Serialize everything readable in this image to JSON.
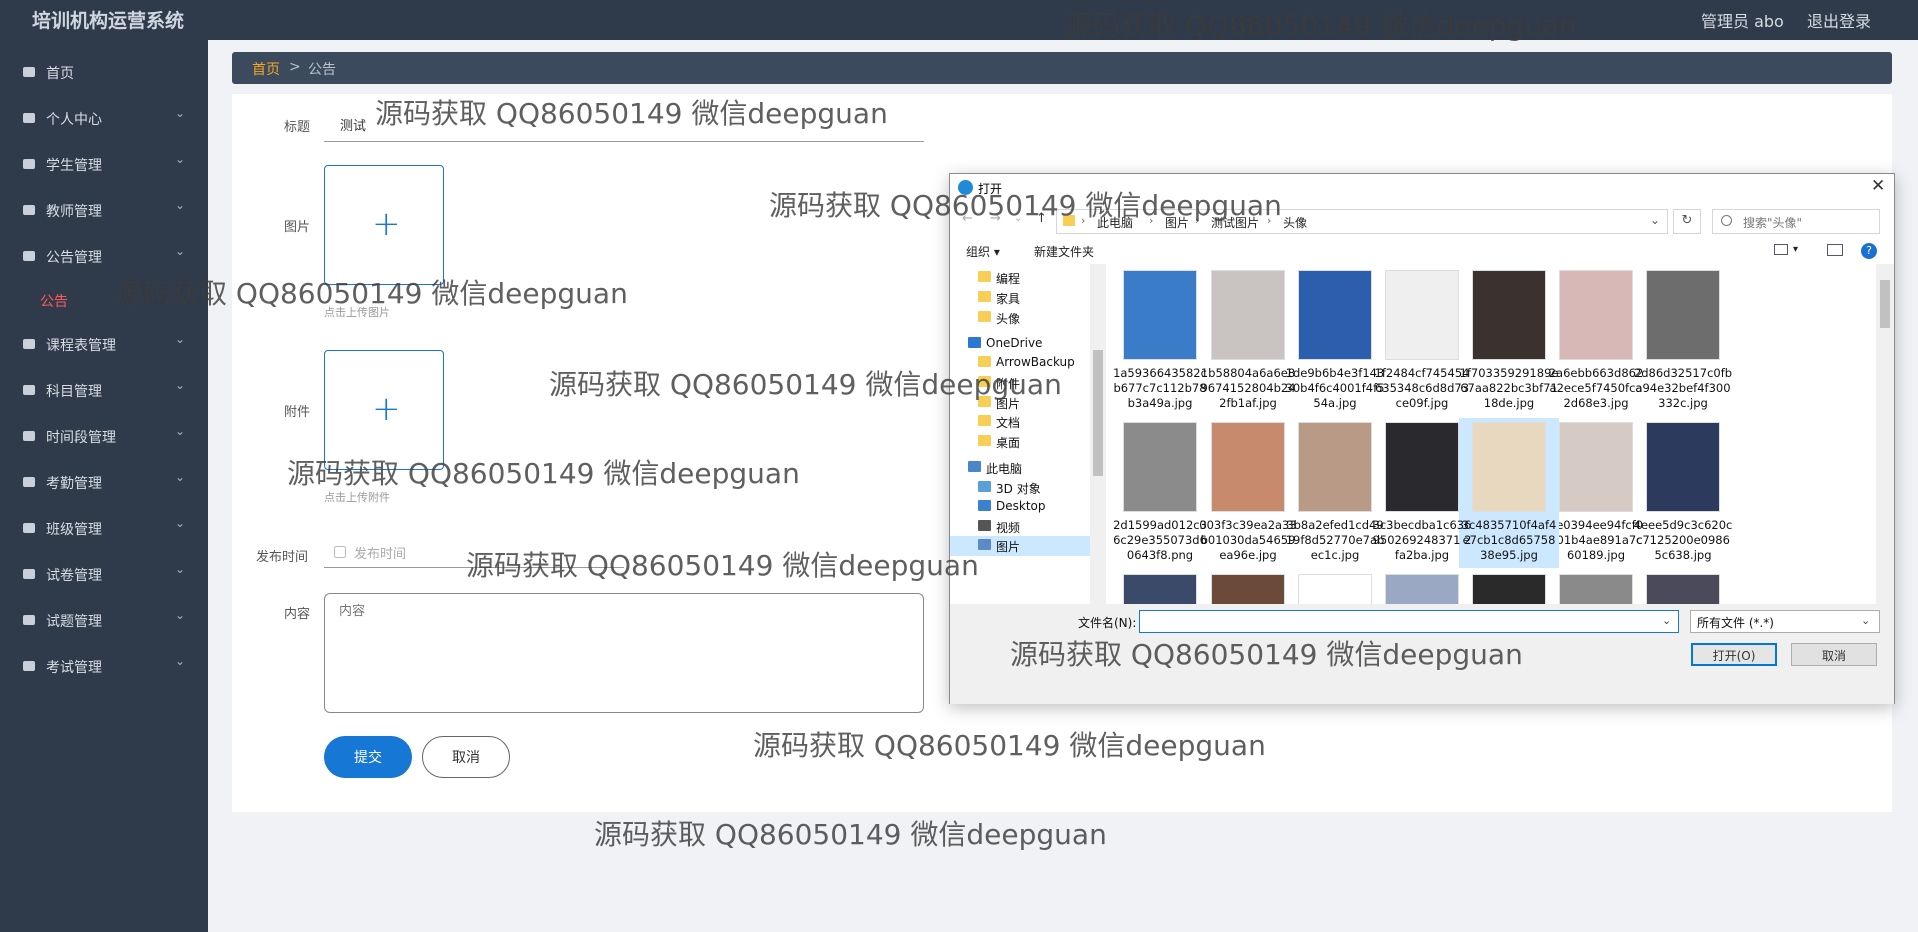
{
  "app": {
    "title": "培训机构运营系统",
    "admin": "管理员 abo",
    "logout": "退出登录"
  },
  "menu": [
    {
      "label": "首页",
      "icon": "home-icon",
      "expandable": false
    },
    {
      "label": "个人中心",
      "icon": "user-icon",
      "expandable": true
    },
    {
      "label": "学生管理",
      "icon": "message-icon",
      "expandable": true
    },
    {
      "label": "教师管理",
      "icon": "chart-icon",
      "expandable": true
    },
    {
      "label": "公告管理",
      "icon": "grid-icon",
      "expandable": true
    },
    {
      "label": "公告",
      "icon": "",
      "expandable": false,
      "sub": true
    },
    {
      "label": "课程表管理",
      "icon": "clock-icon",
      "expandable": true
    },
    {
      "label": "科目管理",
      "icon": "monitor-icon",
      "expandable": true
    },
    {
      "label": "时间段管理",
      "icon": "target-icon",
      "expandable": true
    },
    {
      "label": "考勤管理",
      "icon": "chat-icon",
      "expandable": true
    },
    {
      "label": "班级管理",
      "icon": "power-icon",
      "expandable": true
    },
    {
      "label": "试卷管理",
      "icon": "stamp-icon",
      "expandable": true
    },
    {
      "label": "试题管理",
      "icon": "copy-icon",
      "expandable": true
    },
    {
      "label": "考试管理",
      "icon": "card-icon",
      "expandable": true
    }
  ],
  "breadcrumb": {
    "home": "首页",
    "sep": ">",
    "current": "公告"
  },
  "form": {
    "title_label": "标题",
    "title_value": "测试",
    "image_label": "图片",
    "image_hint": "点击上传图片",
    "attach_label": "附件",
    "attach_hint": "点击上传附件",
    "date_label": "发布时间",
    "date_placeholder": "发布时间",
    "content_label": "内容",
    "content_placeholder": "内容",
    "submit": "提交",
    "cancel": "取消",
    "plus": "+"
  },
  "dialog": {
    "title": "打开",
    "close": "✕",
    "nav": {
      "back": "←",
      "forward": "→",
      "dropdown": "⌄",
      "up": "↑"
    },
    "address": [
      "此电脑",
      "图片",
      "测试图片",
      "头像"
    ],
    "crumb_sep": "›",
    "refresh": "↻",
    "search_placeholder": "搜索\"头像\"",
    "toolbar": {
      "organize": "组织 ▾",
      "new_folder": "新建文件夹",
      "view_dd": "▾",
      "help": "?"
    },
    "tree": [
      {
        "label": "编程",
        "type": "folder"
      },
      {
        "label": "家具",
        "type": "folder"
      },
      {
        "label": "头像",
        "type": "folder"
      },
      {
        "label": "OneDrive",
        "type": "cloud"
      },
      {
        "label": "ArrowBackup",
        "type": "folder"
      },
      {
        "label": "附件",
        "type": "folder"
      },
      {
        "label": "图片",
        "type": "folder"
      },
      {
        "label": "文档",
        "type": "folder"
      },
      {
        "label": "桌面",
        "type": "folder"
      },
      {
        "label": "此电脑",
        "type": "pc"
      },
      {
        "label": "3D 对象",
        "type": "3d"
      },
      {
        "label": "Desktop",
        "type": "desk"
      },
      {
        "label": "视频",
        "type": "video"
      },
      {
        "label": "图片",
        "type": "pics",
        "selected": true
      }
    ],
    "files": [
      {
        "name": "1a5936643582cb677c7c112b78b3a49a.jpg",
        "color": "#3a7cc8"
      },
      {
        "name": "1b58804a6a6e89674152804b242fb1af.jpg",
        "color": "#c9c4c2"
      },
      {
        "name": "1de9b6b4e3f14330b4f6c4001f4f554a.jpg",
        "color": "#2b5fae"
      },
      {
        "name": "1f2484cf745454635348c6d8d73ce09f.jpg",
        "color": "#efefef"
      },
      {
        "name": "1f70335929189e67aa822bc3bf7118de.jpg",
        "color": "#3b3230"
      },
      {
        "name": "2a6ebb663d862a2ece5f7450fca2d68e3.jpg",
        "color": "#d7b8b7"
      },
      {
        "name": "2d86d32517c0fba94e32bef4f300332c.jpg",
        "color": "#6d6d6d"
      },
      {
        "name": "2d1599ad012c36c29e355073d60643f8.png",
        "color": "#8b8b8b"
      },
      {
        "name": "003f3c39ea2a33b01030da54659ea96e.jpg",
        "color": "#c88a6c"
      },
      {
        "name": "3b8a2efed1cd4919f8d52770e7abec1c.jpg",
        "color": "#b99a86"
      },
      {
        "name": "3c3becdba1c636950269248371 2fa2ba.jpg",
        "color": "#2a2a2e"
      },
      {
        "name": "3c4835710f4af4e7cb1c8d6575838e95.jpg",
        "color": "#e8d8c0",
        "selected": true
      },
      {
        "name": "3e0394ee94fcf0a01b4ae891a7c60189.jpg",
        "color": "#d5cac4"
      },
      {
        "name": "4eee5d9c3c620cc7125200e09865c638.jpg",
        "color": "#2c3a5e"
      },
      {
        "name": "",
        "color": "#3c4a6a"
      },
      {
        "name": "",
        "color": "#6c4a3a"
      },
      {
        "name": "",
        "color": "#ffffff"
      },
      {
        "name": "",
        "color": "#9aa8c4"
      },
      {
        "name": "",
        "color": "#2a2a2a"
      },
      {
        "name": "",
        "color": "#8a8a8a"
      },
      {
        "name": "",
        "color": "#4a4a5a"
      }
    ],
    "filename_label": "文件名(N):",
    "filename_dd": "⌄",
    "filetype": "所有文件 (*.*)",
    "filetype_dd": "⌄",
    "open": "打开(O)",
    "cancel": "取消"
  },
  "watermark": "源码获取 QQ86050149 微信deepguan",
  "colors": {
    "sidebar": "#2f3a4a",
    "accent": "#1677d4",
    "active_sub": "#ff5a5a",
    "breadcrumb_home": "#f5a623"
  }
}
